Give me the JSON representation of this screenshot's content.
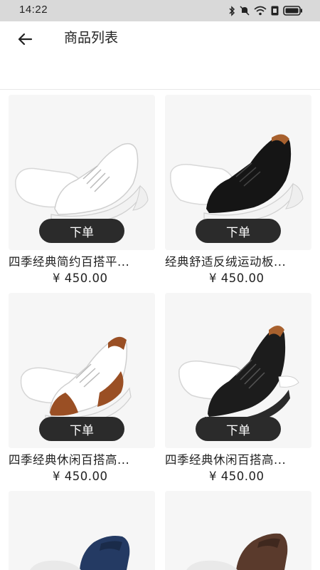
{
  "status_bar": {
    "time": "14:22",
    "icons": [
      "bluetooth-icon",
      "mute-icon",
      "wifi-icon",
      "sim-icon",
      "battery-icon"
    ]
  },
  "header": {
    "back_icon": "arrow-left-icon",
    "title": "商品列表"
  },
  "products": [
    {
      "name": "四季经典简约百搭平...",
      "price": "¥ 450.00",
      "button": "下单",
      "image": "white-leather-sneaker"
    },
    {
      "name": "经典舒适反绒运动板...",
      "price": "¥ 450.00",
      "button": "下单",
      "image": "black-suede-sneaker"
    },
    {
      "name": "四季经典休闲百搭高...",
      "price": "¥ 450.00",
      "button": "下单",
      "image": "white-brown-sneaker"
    },
    {
      "name": "四季经典休闲百搭高...",
      "price": "¥ 450.00",
      "button": "下单",
      "image": "black-leather-sneaker"
    },
    {
      "name": "",
      "price": "",
      "button": "",
      "image": "navy-loafer"
    },
    {
      "name": "",
      "price": "",
      "button": "",
      "image": "brown-loafer"
    }
  ]
}
